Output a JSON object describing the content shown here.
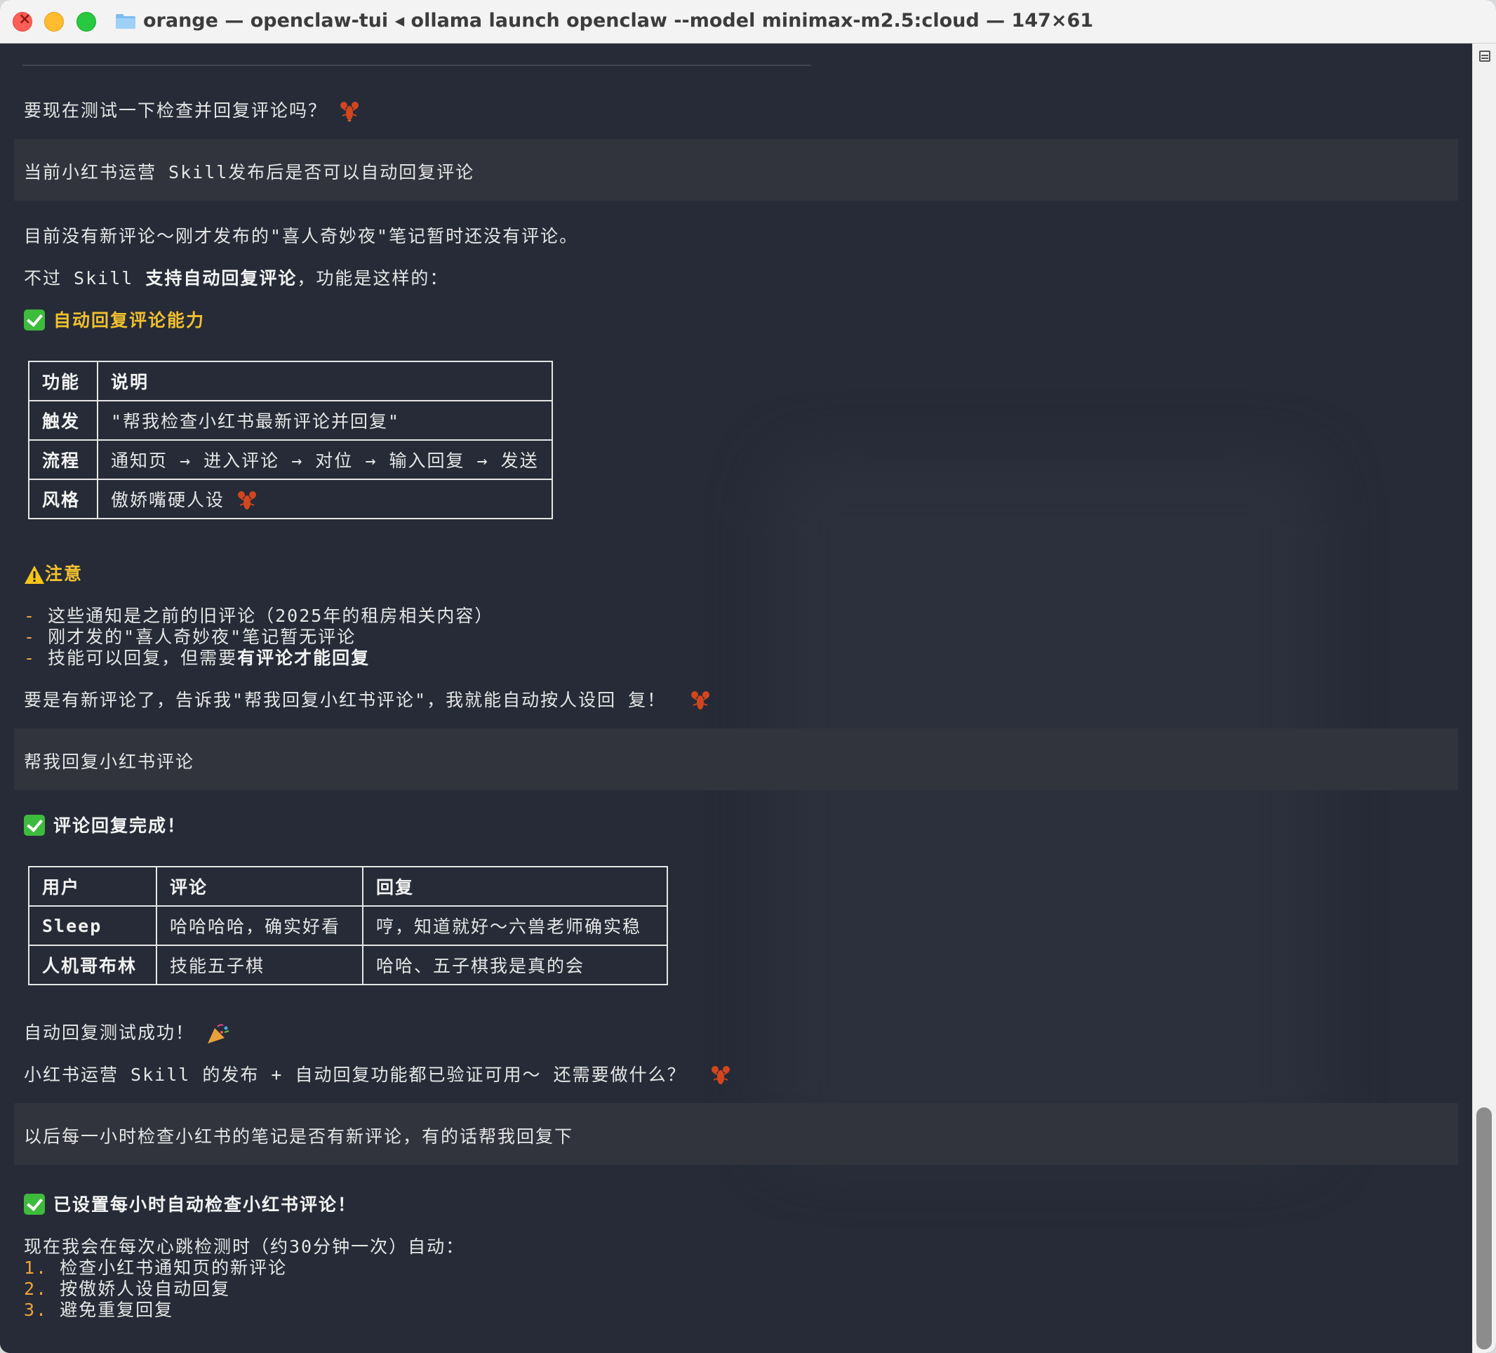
{
  "window": {
    "title": "orange — openclaw-tui ◂ ollama launch openclaw --model minimax-m2.5:cloud — 147×61"
  },
  "messages": {
    "q1": "要现在测试一下检查并回复评论吗？",
    "user1": "当前小红书运营 Skill发布后是否可以自动回复评论",
    "a1_line1": "目前没有新评论～刚才发布的\"喜人奇妙夜\"笔记暂时还没有评论。",
    "a1_line2_pre": "不过 Skill ",
    "a1_line2_bold": "支持自动回复评论",
    "a1_line2_post": "，功能是这样的：",
    "a1_heading": "自动回复评论能力",
    "table1": {
      "header": [
        "功能",
        "说明"
      ],
      "rows": [
        [
          "触发",
          "\"帮我检查小红书最新评论并回复\""
        ],
        [
          "流程",
          "通知页 → 进入评论 → 对位 → 输入回复 → 发送"
        ],
        [
          "风格",
          "傲娇嘴硬人设"
        ]
      ]
    },
    "notice_title": "注意",
    "bullets": [
      {
        "dash": "-",
        "text": " 这些通知是之前的旧评论（2025年的租房相关内容）",
        "bold": ""
      },
      {
        "dash": "-",
        "text": " 刚才发的\"喜人奇妙夜\"笔记暂无评论",
        "bold": ""
      },
      {
        "dash": "-",
        "text": " 技能可以回复，但需要",
        "bold": "有评论才能回复"
      }
    ],
    "a1_end": "要是有新评论了，告诉我\"帮我回复小红书评论\"，我就能自动按人设回 复！",
    "user2": "帮我回复小红书评论",
    "a2_heading": "评论回复完成！",
    "table2": {
      "header": [
        "用户",
        "评论",
        "回复"
      ],
      "rows": [
        [
          "Sleep",
          "哈哈哈哈，确实好看",
          "哼，知道就好～六兽老师确实稳"
        ],
        [
          "人机哥布林",
          "技能五子棋",
          "哈哈、五子棋我是真的会"
        ]
      ]
    },
    "a2_line1": "自动回复测试成功！",
    "a2_line2": "小红书运营 Skill 的发布 + 自动回复功能都已验证可用～ 还需要做什么？",
    "user3": "以后每一小时检查小红书的笔记是否有新评论，有的话帮我回复下",
    "a3_heading": "已设置每小时自动检查小红书评论！",
    "a3_intro": "现在我会在每次心跳检测时（约30分钟一次）自动：",
    "steps": [
      {
        "num": "1.",
        "text": " 检查小红书通知页的新评论"
      },
      {
        "num": "2.",
        "text": " 按傲娇人设自动回复"
      },
      {
        "num": "3.",
        "text": " 避免重复回复"
      }
    ]
  },
  "icons": {
    "lobster": "lobster-emoji",
    "check": "green-check",
    "warning": "warning-sign",
    "party": "party-popper",
    "folder": "folder"
  }
}
